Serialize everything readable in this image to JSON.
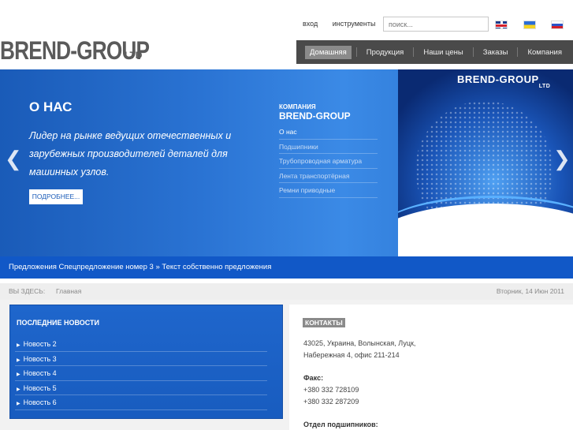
{
  "toplinks": {
    "login": "вход",
    "tools": "инструменты"
  },
  "search": {
    "placeholder": "поиск..."
  },
  "flags": [
    "uk-flag-icon",
    "ua-flag-icon",
    "ru-flag-icon"
  ],
  "logo": {
    "main": "BREND-GROUP",
    "suffix": "LTD"
  },
  "nav": {
    "items": [
      {
        "label": "Домашняя",
        "active": true
      },
      {
        "label": "Продукция"
      },
      {
        "label": "Наши цены"
      },
      {
        "label": "Заказы"
      },
      {
        "label": "Компания"
      }
    ]
  },
  "slider": {
    "title": "О НАС",
    "text": "Лидер на рынке ведущих отечественных и зарубежных производителей деталей для машинных узлов.",
    "more": "ПОДРОБНЕЕ...",
    "side_heading_small": "КОМПАНИЯ",
    "side_heading_big": "BREND-GROUP",
    "side_items": [
      "О нас",
      "Подшипники",
      "Трубопроводная арматура",
      "Лента транспортёрная",
      "Ремни приводные"
    ],
    "image_logo": "BREND-GROUP",
    "image_logo_suffix": "LTD",
    "accent_color": "#1a5bb8"
  },
  "offer": {
    "text": "Предложения  Спецпредложение номер 3 » Текст собственно предложения"
  },
  "breadcrumb": {
    "here": "ВЫ ЗДЕСЬ:",
    "home": "Главная",
    "date": "Вторник, 14 Июн 2011"
  },
  "news": {
    "title": "ПОСЛЕДНИЕ НОВОСТИ",
    "items": [
      "Новость 2",
      "Новость 3",
      "Новость 4",
      "Новость 5",
      "Новость 6"
    ]
  },
  "contacts": {
    "title": "КОНТАКТЫ",
    "address1": "43025, Украина, Волынская, Луцк,",
    "address2": "Набережная 4, офис 211-214",
    "fax_label": "Факс:",
    "fax1": "+380 332 728109",
    "fax2": "+380 332 287209",
    "dept": "Отдел подшипников:"
  }
}
